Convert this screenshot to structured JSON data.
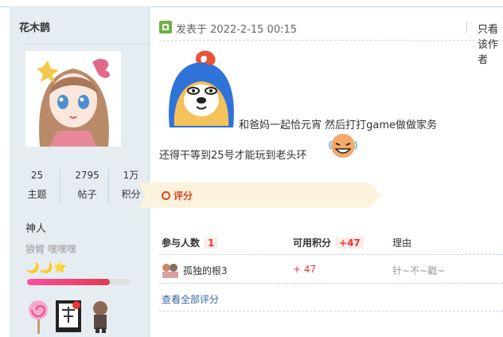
{
  "user": {
    "name": "花木鹊",
    "stats": [
      {
        "value": "25",
        "label": "主题"
      },
      {
        "value": "2795",
        "label": "帖子"
      },
      {
        "value": "1万",
        "label": "积分"
      }
    ],
    "rank": "神人",
    "custom_title": "狼臂 嘿嘿嘿",
    "stars": "🌙🌙⭐",
    "level_progress": 0.8,
    "colors": {
      "sidebar_bg": "#e5edf2",
      "progress": "#e03a50"
    }
  },
  "post": {
    "time_label": "发表于 2022-2-15 00:15",
    "only_author": "只看该作者",
    "line1": "和爸妈一起恰元宵 然后打打game做做家务",
    "line2": "还得干等到25号才能玩到老头环"
  },
  "rating": {
    "title": "评分",
    "col_participants": "参与人数",
    "participants_count": "1",
    "col_points": "可用积分",
    "points_total": "+47",
    "col_reason": "理由",
    "rows": [
      {
        "user": "孤独的根3",
        "score": "+ 47",
        "reason": "针~不~戳~"
      }
    ],
    "view_all": "查看全部评分"
  }
}
